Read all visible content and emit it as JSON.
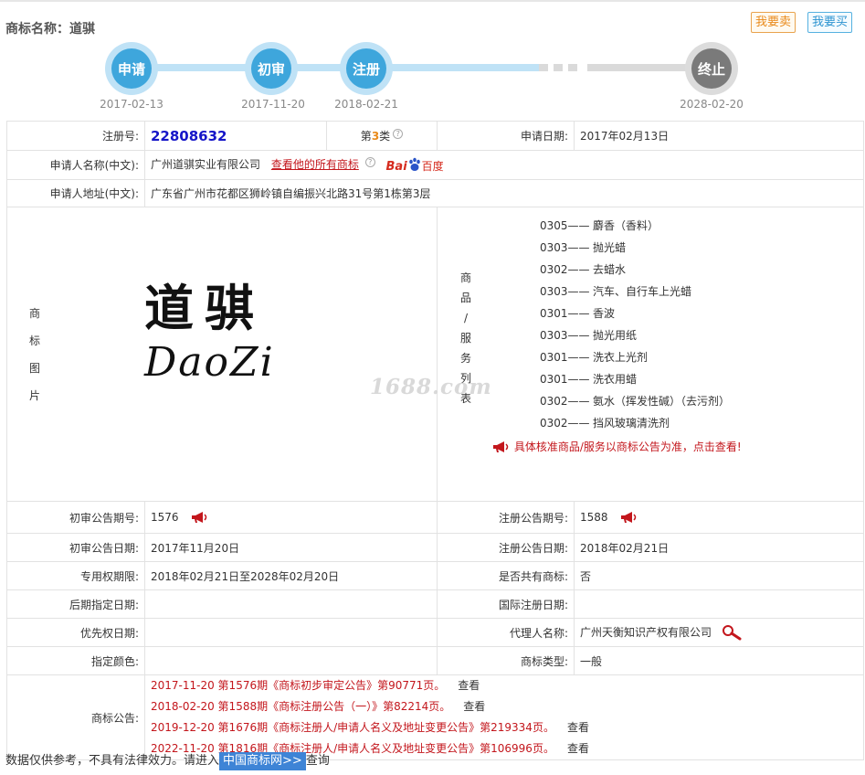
{
  "header": {
    "title": "商标名称：道骐",
    "sell_button": "我要卖",
    "buy_button": "我要买"
  },
  "timeline": {
    "steps": [
      {
        "label": "申请",
        "date": "2017-02-13",
        "state": "done"
      },
      {
        "label": "初审",
        "date": "2017-11-20",
        "state": "done"
      },
      {
        "label": "注册",
        "date": "2018-02-21",
        "state": "done"
      },
      {
        "label": "终止",
        "date": "2028-02-20",
        "state": "future"
      }
    ]
  },
  "colors": {
    "accent_blue": "#3ea6dc",
    "link_red": "#c3161c",
    "class_orange": "#e98a1a",
    "regno_blue": "#1515c8"
  },
  "info": {
    "reg_no_label": "注册号:",
    "reg_no": "22808632",
    "class_prefix": "第",
    "class_num": "3",
    "class_suffix": "类",
    "help_icon": "?",
    "apply_date_label": "申请日期:",
    "apply_date": "2017年02月13日",
    "applicant_label": "申请人名称(中文):",
    "applicant": "广州道骐实业有限公司",
    "all_marks_link": "查看他的所有商标",
    "baidu_text_a": "Bai",
    "baidu_text_b": "百度",
    "address_label": "申请人地址(中文):",
    "address": "广东省广州市花都区狮岭镇自编振兴北路31号第1栋第3层",
    "image_label": [
      "商",
      "标",
      "图",
      "片"
    ],
    "goods_label": [
      "商",
      "品",
      "/",
      "服",
      "务",
      "列",
      "表"
    ],
    "mark_text_cn": "道骐",
    "mark_text_en": "DaoZi",
    "watermark": "1688.com",
    "goods": [
      {
        "code": "0305——",
        "name": "麝香（香料）"
      },
      {
        "code": "0303——",
        "name": "抛光蜡"
      },
      {
        "code": "0302——",
        "name": "去蜡水"
      },
      {
        "code": "0303——",
        "name": "汽车、自行车上光蜡"
      },
      {
        "code": "0301——",
        "name": "香波"
      },
      {
        "code": "0303——",
        "name": "抛光用纸"
      },
      {
        "code": "0301——",
        "name": "洗衣上光剂"
      },
      {
        "code": "0301——",
        "name": "洗衣用蜡"
      },
      {
        "code": "0302——",
        "name": "氨水（挥发性碱）（去污剂）"
      },
      {
        "code": "0302——",
        "name": "挡风玻璃清洗剂"
      }
    ],
    "goods_notice": "具体核准商品/服务以商标公告为准，点击查看!",
    "prelim_no_label": "初审公告期号:",
    "prelim_no": "1576",
    "reg_pub_no_label": "注册公告期号:",
    "reg_pub_no": "1588",
    "prelim_date_label": "初审公告日期:",
    "prelim_date": "2017年11月20日",
    "reg_pub_date_label": "注册公告日期:",
    "reg_pub_date": "2018年02月21日",
    "exclusive_label": "专用权期限:",
    "exclusive": "2018年02月21日至2028年02月20日",
    "shared_label": "是否共有商标:",
    "shared": "否",
    "later_date_label": "后期指定日期:",
    "later_date": "",
    "intl_date_label": "国际注册日期:",
    "intl_date": "",
    "priority_label": "优先权日期:",
    "priority": "",
    "agent_label": "代理人名称:",
    "agent": "广州天衡知识产权有限公司",
    "color_label": "指定颜色:",
    "color_value": "",
    "type_label": "商标类型:",
    "type_value": "一般",
    "announce_label": "商标公告:",
    "announcements": [
      {
        "text": "2017-11-20 第1576期《商标初步审定公告》第90771页。",
        "view": "查看"
      },
      {
        "text": "2018-02-20 第1588期《商标注册公告（一）》第82214页。",
        "view": "查看"
      },
      {
        "text": "2019-12-20 第1676期《商标注册人/申请人名义及地址变更公告》第219334页。",
        "view": "查看"
      },
      {
        "text": "2022-11-20 第1816期《商标注册人/申请人名义及地址变更公告》第106996页。",
        "view": "查看"
      }
    ]
  },
  "footer": {
    "prefix": "数据仅供参考，不具有法律效力。请进入",
    "link": "中国商标网>>",
    "suffix": "查询"
  }
}
